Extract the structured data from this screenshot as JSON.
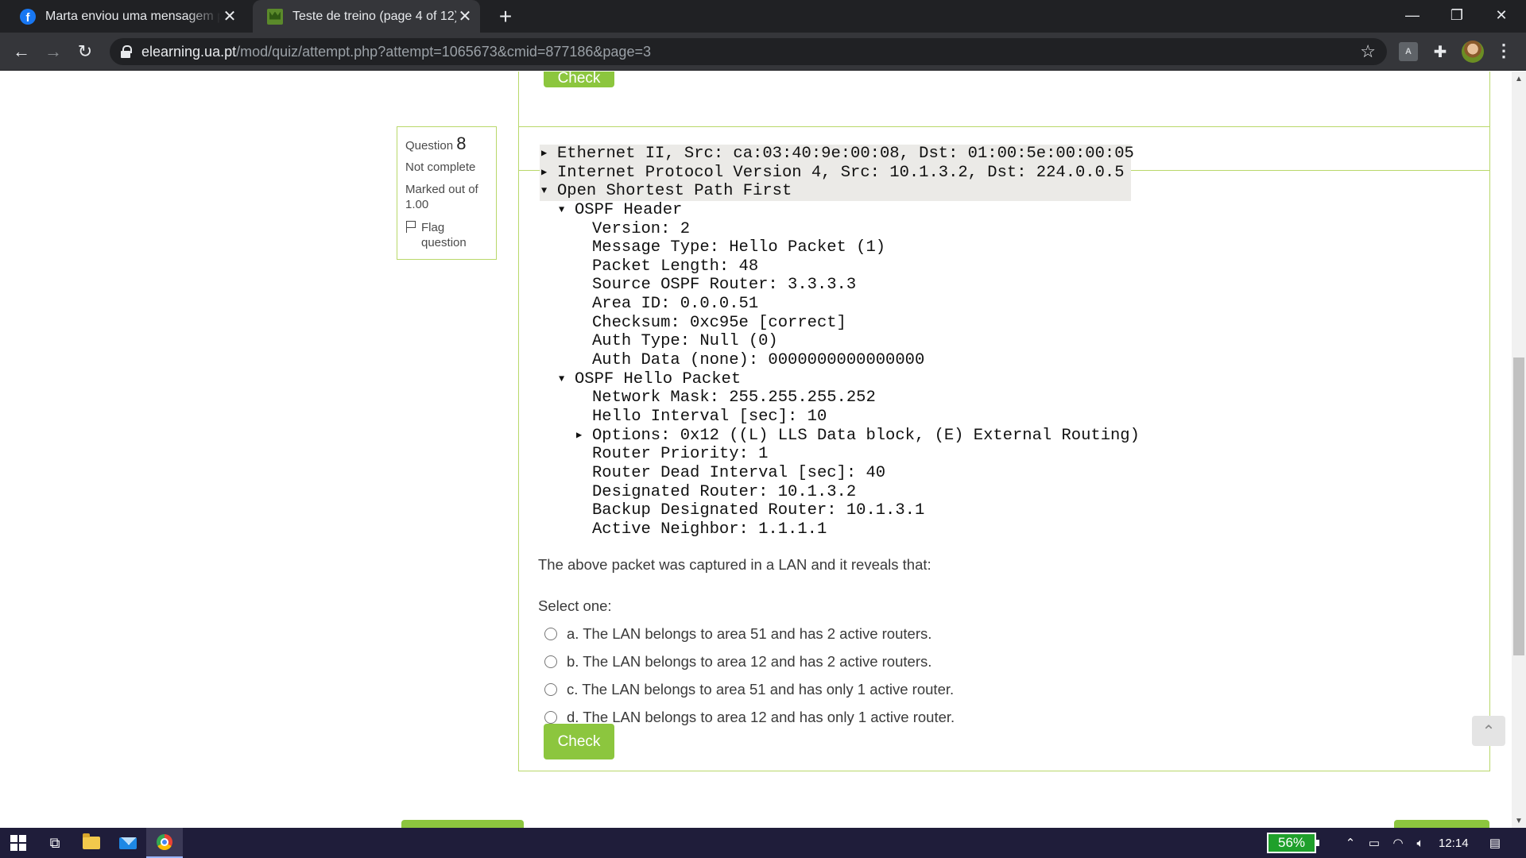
{
  "browser": {
    "tabs": [
      {
        "title": "Marta enviou uma mensagem para você",
        "favicon": "facebook-icon"
      },
      {
        "title": "Teste de treino (page 4 of 12)",
        "favicon": "ua-moodle-icon"
      }
    ],
    "url": {
      "host": "elearning.ua.pt",
      "path": "/mod/quiz/attempt.php?attempt=1065673&cmid=877186&page=3"
    }
  },
  "previous_question": {
    "check_label": "Check"
  },
  "question": {
    "prefix": "Question",
    "number": "8",
    "state": "Not complete",
    "grade": "Marked out of 1.00",
    "flag_label": "Flag question",
    "packet": {
      "frames": [
        "Ethernet II, Src: ca:03:40:9e:00:08, Dst: 01:00:5e:00:00:05",
        "Internet Protocol Version 4, Src: 10.1.3.2, Dst: 224.0.0.5",
        "Open Shortest Path First"
      ],
      "header_title": "OSPF Header",
      "header_fields": [
        "Version: 2",
        "Message Type: Hello Packet (1)",
        "Packet Length: 48",
        "Source OSPF Router: 3.3.3.3",
        "Area ID: 0.0.0.51",
        "Checksum: 0xc95e [correct]",
        "Auth Type: Null (0)",
        "Auth Data (none): 0000000000000000"
      ],
      "hello_title": "OSPF Hello Packet",
      "hello_fields": [
        "Network Mask: 255.255.255.252",
        "Hello Interval [sec]: 10",
        "Options: 0x12 ((L) LLS Data block, (E) External Routing)",
        "Router Priority: 1",
        "Router Dead Interval [sec]: 40",
        "Designated Router: 10.1.3.2",
        "Backup Designated Router: 10.1.3.1",
        "Active Neighbor: 1.1.1.1"
      ]
    },
    "text": "The above packet was captured in a LAN and it reveals that:",
    "prompt": "Select one:",
    "answers": [
      "a. The LAN belongs to area 51 and has 2 active routers.",
      "b. The LAN belongs to area 12 and has 2 active routers.",
      "c. The LAN belongs to area 51 and has only 1 active router.",
      "d. The LAN belongs to area 12 and has only 1 active router."
    ],
    "check_label": "Check"
  },
  "taskbar": {
    "battery": "56%",
    "time": "12:14"
  },
  "colors": {
    "accent_green": "#8cc63e",
    "box_border": "#b9d86a",
    "chrome_dark": "#202124"
  }
}
